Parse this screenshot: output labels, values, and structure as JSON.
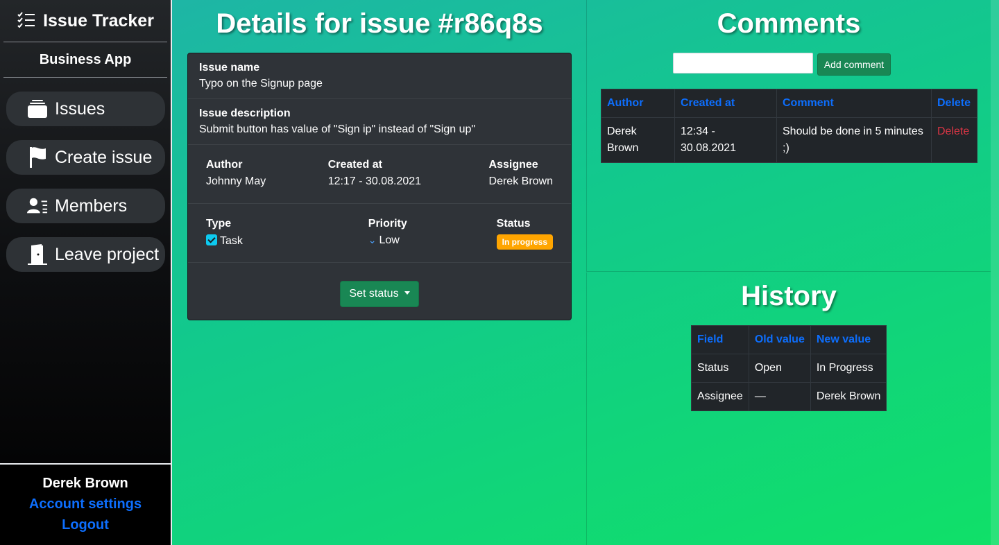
{
  "sidebar": {
    "brand": "Issue Tracker",
    "app_name": "Business App",
    "nav": {
      "issues": "Issues",
      "create_issue": "Create issue",
      "members": "Members",
      "leave_project": "Leave project"
    },
    "user": {
      "name": "Derek Brown",
      "account_settings": "Account settings",
      "logout": "Logout"
    }
  },
  "details": {
    "title": "Details for issue #r86q8s",
    "issue_name_label": "Issue name",
    "issue_name": "Typo on the Signup page",
    "issue_description_label": "Issue description",
    "issue_description": "Submit button has value of \"Sign ip\" instead of \"Sign up\"",
    "author_label": "Author",
    "author": "Johnny May",
    "created_at_label": "Created at",
    "created_at": "12:17 - 30.08.2021",
    "assignee_label": "Assignee",
    "assignee": "Derek Brown",
    "type_label": "Type",
    "type": "Task",
    "priority_label": "Priority",
    "priority": "Low",
    "status_label": "Status",
    "status": "In progress",
    "status_color": "#ffa500",
    "set_status_button": "Set status"
  },
  "comments": {
    "title": "Comments",
    "input_placeholder": "",
    "add_button": "Add comment",
    "headers": [
      "Author",
      "Created at",
      "Comment",
      "Delete"
    ],
    "rows": [
      {
        "author": "Derek Brown",
        "created_at": "12:34 - 30.08.2021",
        "comment": "Should be done in 5 minutes ;)",
        "delete": "Delete"
      }
    ]
  },
  "history": {
    "title": "History",
    "headers": [
      "Field",
      "Old value",
      "New value"
    ],
    "rows": [
      {
        "field": "Status",
        "old": "Open",
        "new": "In Progress"
      },
      {
        "field": "Assignee",
        "old": "—",
        "new": "Derek Brown"
      }
    ]
  },
  "colors": {
    "accent": "#0d6efd",
    "success": "#198754",
    "danger": "#dc3545",
    "warning": "#ffa500"
  }
}
